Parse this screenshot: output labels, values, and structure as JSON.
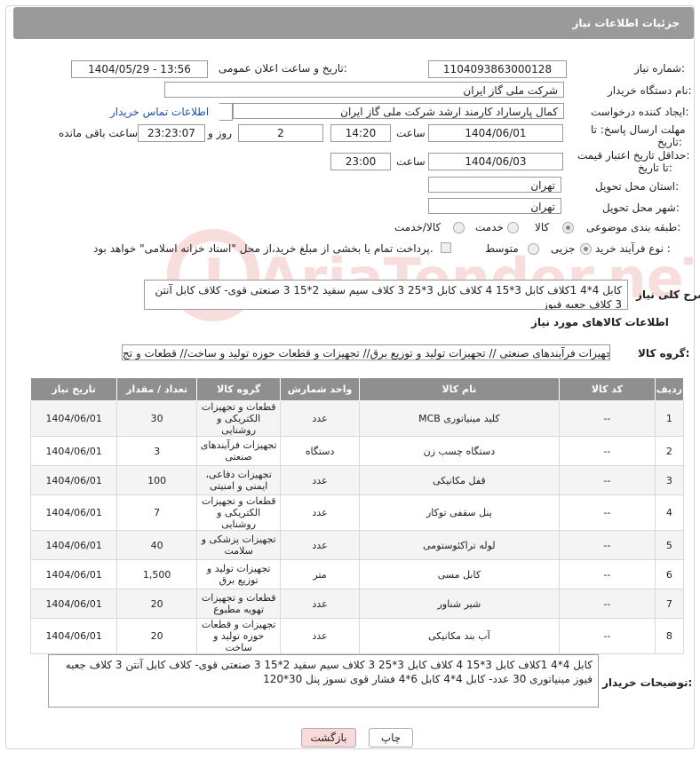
{
  "header": {
    "title": "جزئیات اطلاعات نیاز"
  },
  "fields": {
    "need_number_label": "شماره نیاز:",
    "need_number": "1104093863000128",
    "announce_label": "تاریخ و ساعت اعلان عمومی:",
    "announce_value": "1404/05/29 - 13:56",
    "buyer_org_label": "نام دستگاه خریدار:",
    "buyer_org": "شرکت ملی گاز ایران",
    "creator_label": "ایجاد کننده درخواست:",
    "creator": "کمال پارساراد کارمند ارشد شرکت ملی گاز ایران",
    "contact_link": "اطلاعات تماس خریدار",
    "deadline_label_1": "مهلت ارسال پاسخ: تا",
    "deadline_label_2": "تاریخ:",
    "deadline_date": "1404/06/01",
    "time_label": "ساعت",
    "deadline_time": "14:20",
    "days_value": "2",
    "days_label": "روز و",
    "remaining_time": "23:23:07",
    "remaining_label": "ساعت باقی مانده",
    "price_label_1": "حداقل تاریخ اعتبار قیمت:",
    "price_label_2": "تا تاریخ:",
    "price_date": "1404/06/03",
    "price_time": "23:00",
    "province_label": "استان محل تحویل:",
    "province": "تهران",
    "city_label": "شهر محل تحویل:",
    "city": "تهران",
    "category_label": "طبقه بندی موضوعی:",
    "cat_goods": "کالا",
    "cat_service": "خدمت",
    "cat_both": "کالا/خدمت",
    "process_label": "نوع فرآیند خرید :",
    "proc_partial": "جزیی",
    "proc_medium": "متوسط",
    "payment_note": "پرداخت تمام یا بخشی از مبلغ خرید،از محل \"اسناد خزانه اسلامی\" خواهد بود."
  },
  "summary": {
    "label": "شرح کلی نیاز:",
    "text": "کابل 4*4 1کلاف کابل 3*15 4 کلاف کابل 3*25 3 کلاف سیم سفید 2*15 3 صنعتی قوی- کلاف کابل آنتن 3 کلاف جعبه فیوز"
  },
  "goods_section": {
    "title": "اطلاعات کالاهای مورد نیاز",
    "group_label": "گروه کالا:",
    "group_value": "تجهیزات فرآیندهای صنعتی // تجهیزات تولید و توزیع برق// تجهیزات و قطعات حوزه تولید و ساخت// قطعات و تج"
  },
  "table": {
    "headers": [
      "ردیف",
      "کد کالا",
      "نام کالا",
      "واحد شمارش",
      "گروه کالا",
      "تعداد / مقدار",
      "تاریخ نیاز"
    ],
    "rows": [
      [
        "1",
        "--",
        "کلید مینیاتوری MCB",
        "عدد",
        "قطعات و تجهیزات الکتریکی و روشنایی",
        "30",
        "1404/06/01"
      ],
      [
        "2",
        "--",
        "دستگاه چسب زن",
        "دستگاه",
        "تجهیزات فرآیندهای صنعتی",
        "3",
        "1404/06/01"
      ],
      [
        "3",
        "--",
        "قفل مکانیکی",
        "عدد",
        "تجهیزات دفاعی، ایمنی و امنیتی",
        "100",
        "1404/06/01"
      ],
      [
        "4",
        "--",
        "پنل سقفی توکار",
        "عدد",
        "قطعات و تجهیزات الکتریکی و روشنایی",
        "7",
        "1404/06/01"
      ],
      [
        "5",
        "--",
        "لوله تراکئوستومی",
        "عدد",
        "تجهیزات پزشکی و سلامت",
        "40",
        "1404/06/01"
      ],
      [
        "6",
        "--",
        "کابل مسی",
        "متر",
        "تجهیزات تولید و توزیع برق",
        "1,500",
        "1404/06/01"
      ],
      [
        "7",
        "--",
        "شیر شناور",
        "عدد",
        "قطعات و تجهیزات تهویه مطبوع",
        "20",
        "1404/06/01"
      ],
      [
        "8",
        "--",
        "آب بند مکانیکی",
        "عدد",
        "تجهیزات و قطعات حوزه تولید و ساخت",
        "20",
        "1404/06/01"
      ]
    ]
  },
  "buyer_notes": {
    "label": "توضیحات خریدار:",
    "text": "کابل 4*4 1کلاف کابل 3*15 4 کلاف کابل 3*25 3 کلاف سیم سفید 2*15 3 صنعتی قوی- کلاف کابل آنتن 3 کلاف جعبه فیوز مینیاتوری 30 عدد- کابل 4*4 کابل 6*4 فشار قوی نسوز پنل 30*120"
  },
  "buttons": {
    "print": "چاپ",
    "back": "بازگشت"
  },
  "watermark": {
    "text": "AriaTender.neT"
  },
  "colors": {
    "header_bg": "#9a9a9a",
    "link": "#1a4fb0",
    "back_btn": "#f9d9d9",
    "print_btn": "#ffffff"
  }
}
